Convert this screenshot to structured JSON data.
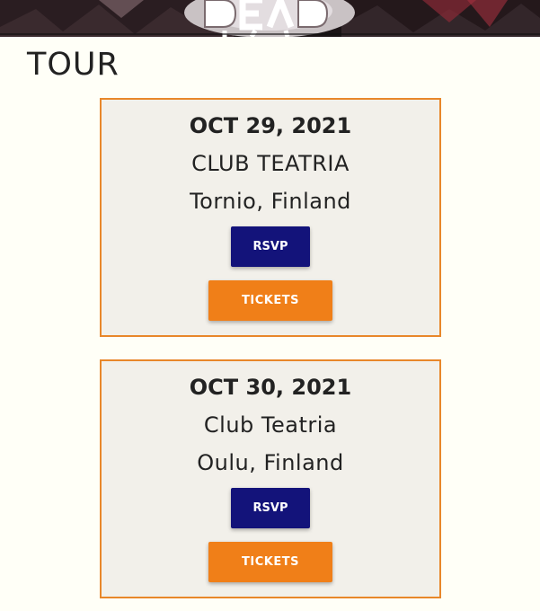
{
  "section_title": "TOUR",
  "events": [
    {
      "date": "OCT 29, 2021",
      "venue": "CLUB TEATRIA",
      "location": "Tornio, Finland",
      "rsvp_label": "RSVP",
      "tickets_label": "TICKETS"
    },
    {
      "date": "OCT 30, 2021",
      "venue": "Club Teatria",
      "location": "Oulu, Finland",
      "rsvp_label": "RSVP",
      "tickets_label": "TICKETS"
    }
  ],
  "colors": {
    "page_background": "#fffff7",
    "card_border": "#e8872a",
    "card_background": "#f2f0ea",
    "rsvp_button": "#13137a",
    "tickets_button": "#f07f18"
  }
}
